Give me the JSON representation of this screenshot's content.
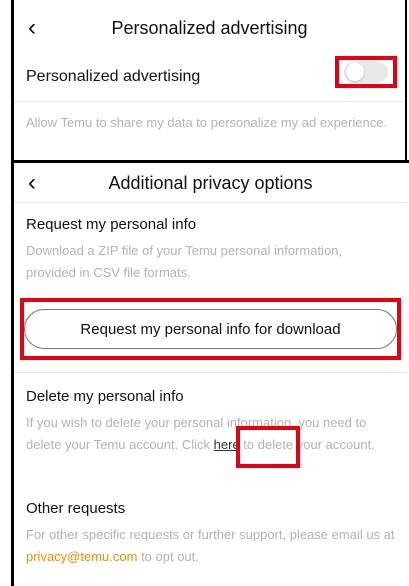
{
  "top_screen": {
    "title": "Personalized advertising",
    "row_label": "Personalized advertising",
    "toggle_state": "off",
    "description": "Allow Temu to share my data to personalize my ad experience."
  },
  "bottom_screen": {
    "title": "Additional privacy options",
    "request_section": {
      "title": "Request my personal info",
      "description": "Download a ZIP file of your Temu personal information, provided in CSV file formats.",
      "button_label": "Request my personal info for download"
    },
    "delete_section": {
      "title": "Delete my personal info",
      "text_before": "If you wish to delete your personal information, you need to delete your Temu account. Click ",
      "link_text": "here",
      "text_after": " to delete your account."
    },
    "other_section": {
      "title": "Other requests",
      "text_before": "For other specific requests or further support, please email us at ",
      "email": "privacy@temu.com",
      "text_after": " to opt out."
    }
  },
  "colors": {
    "highlight": "#e60012",
    "email": "#f28c00",
    "muted_text": "#b3b3b3"
  }
}
